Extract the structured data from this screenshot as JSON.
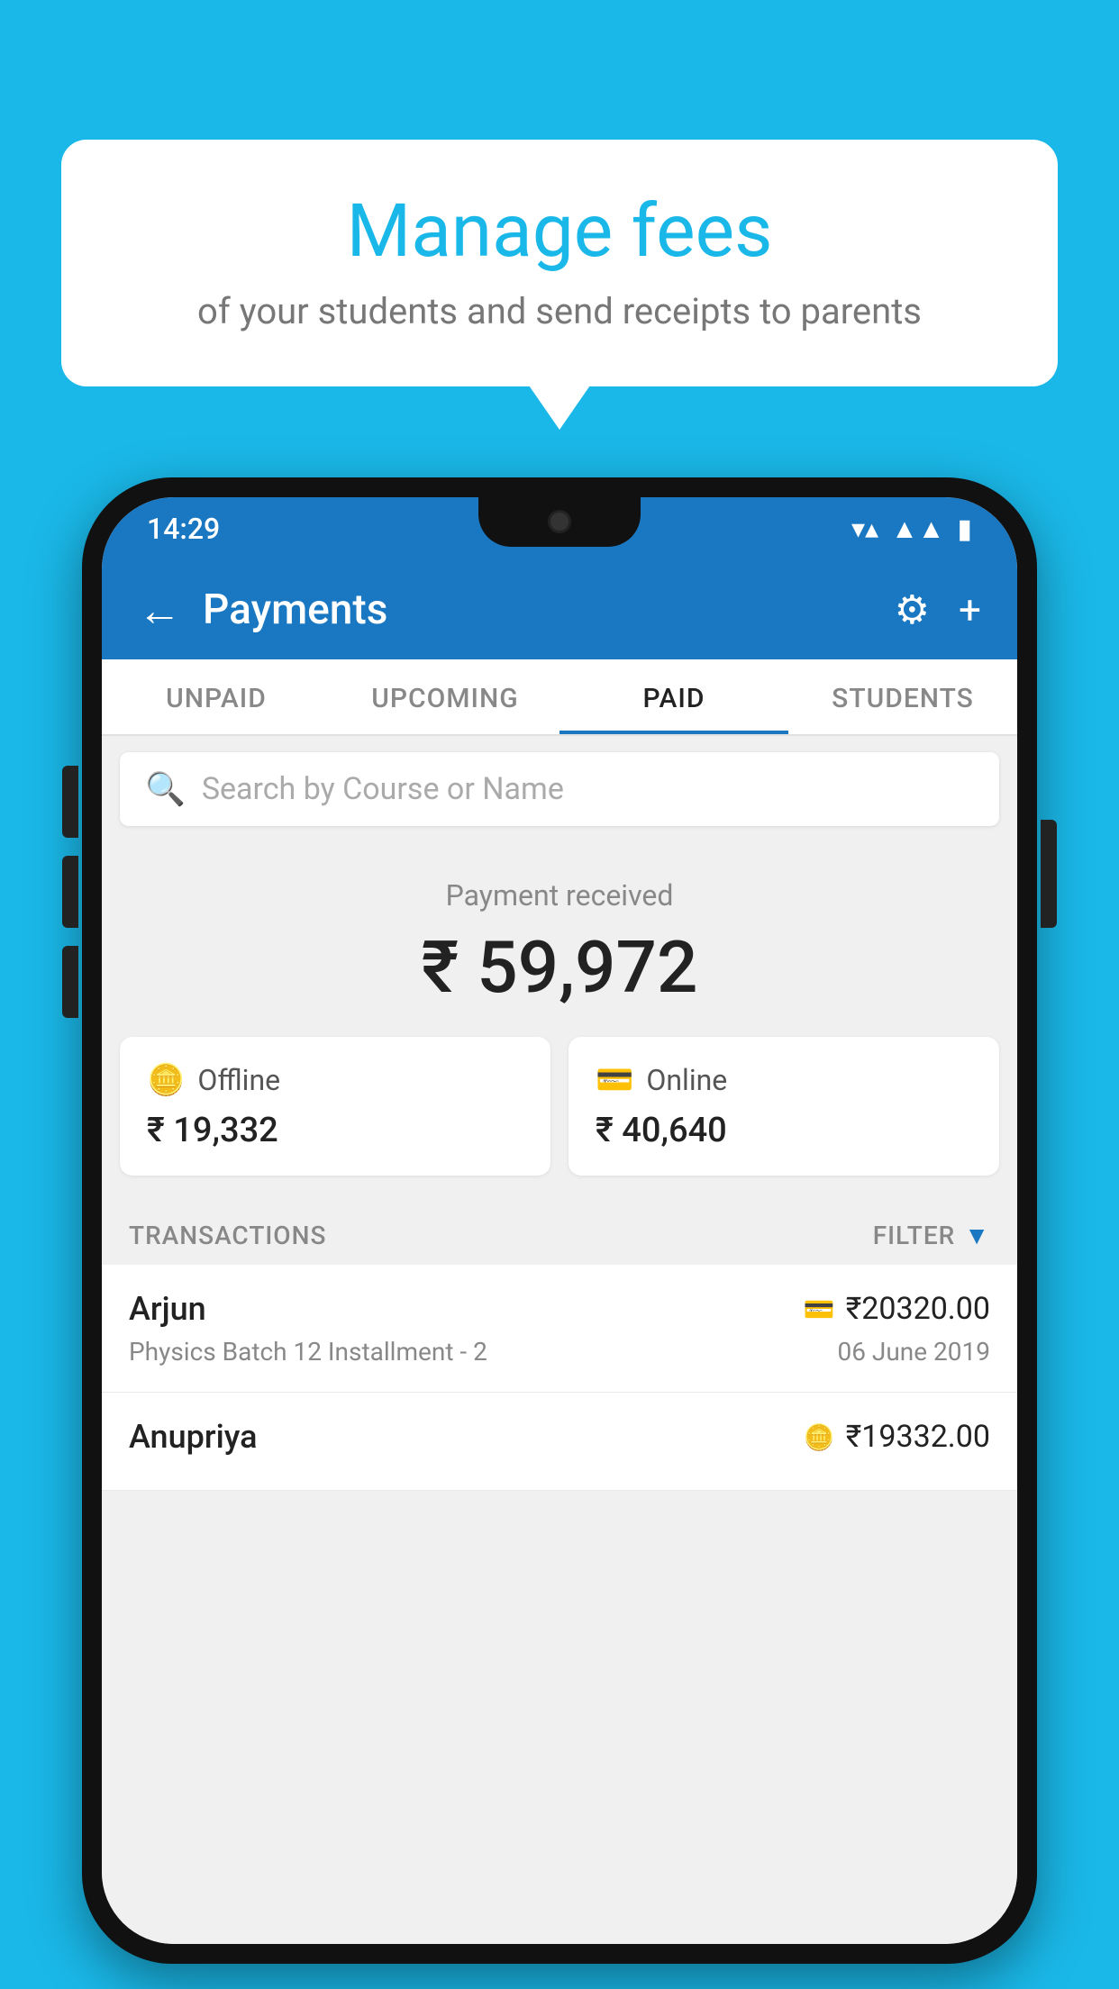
{
  "background": {
    "color": "#1ab8e8"
  },
  "speech_bubble": {
    "title": "Manage fees",
    "subtitle": "of your students and send receipts to parents"
  },
  "phone": {
    "status_bar": {
      "time": "14:29"
    },
    "app_bar": {
      "title": "Payments",
      "back_label": "←",
      "gear_label": "⚙",
      "plus_label": "+"
    },
    "tabs": [
      {
        "label": "UNPAID",
        "active": false
      },
      {
        "label": "UPCOMING",
        "active": false
      },
      {
        "label": "PAID",
        "active": true
      },
      {
        "label": "STUDENTS",
        "active": false
      }
    ],
    "search": {
      "placeholder": "Search by Course or Name"
    },
    "payment_summary": {
      "label": "Payment received",
      "amount": "₹ 59,972"
    },
    "payment_cards": [
      {
        "label": "Offline",
        "amount": "₹ 19,332",
        "icon": "offline"
      },
      {
        "label": "Online",
        "amount": "₹ 40,640",
        "icon": "online"
      }
    ],
    "transactions_section": {
      "label": "TRANSACTIONS",
      "filter_label": "FILTER"
    },
    "transactions": [
      {
        "name": "Arjun",
        "amount": "₹20320.00",
        "payment_icon": "card",
        "description": "Physics Batch 12 Installment - 2",
        "date": "06 June 2019"
      },
      {
        "name": "Anupriya",
        "amount": "₹19332.00",
        "payment_icon": "offline",
        "description": "",
        "date": ""
      }
    ]
  }
}
